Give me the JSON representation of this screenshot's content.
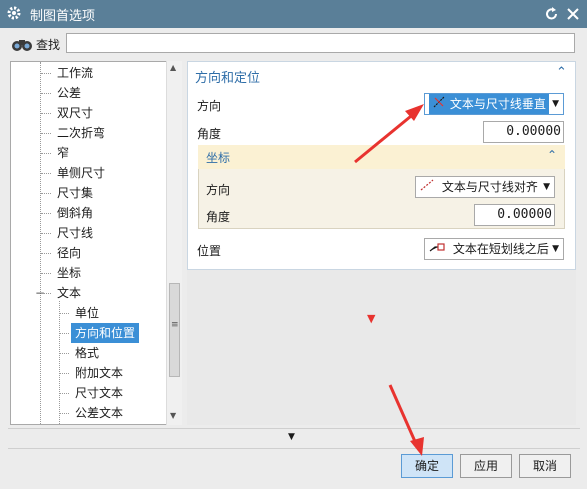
{
  "window": {
    "title": "制图首选项"
  },
  "search": {
    "label": "查找",
    "value": ""
  },
  "tree": {
    "items": [
      {
        "label": "工作流",
        "level": 1
      },
      {
        "label": "公差",
        "level": 1
      },
      {
        "label": "双尺寸",
        "level": 1
      },
      {
        "label": "二次折弯",
        "level": 1
      },
      {
        "label": "窄",
        "level": 1
      },
      {
        "label": "单侧尺寸",
        "level": 1
      },
      {
        "label": "尺寸集",
        "level": 1
      },
      {
        "label": "倒斜角",
        "level": 1
      },
      {
        "label": "尺寸线",
        "level": 1
      },
      {
        "label": "径向",
        "level": 1
      },
      {
        "label": "坐标",
        "level": 1
      },
      {
        "label": "文本",
        "level": 1,
        "expanded": true
      },
      {
        "label": "单位",
        "level": 2
      },
      {
        "label": "方向和位置",
        "level": 2,
        "selected": true
      },
      {
        "label": "格式",
        "level": 2
      },
      {
        "label": "附加文本",
        "level": 2
      },
      {
        "label": "尺寸文本",
        "level": 2
      },
      {
        "label": "公差文本",
        "level": 2
      }
    ],
    "collapse_glyph": "−"
  },
  "section": {
    "title": "方向和定位",
    "orientation_label": "方向",
    "orientation_value": "文本与尺寸线垂直",
    "angle_label": "角度",
    "angle_value": "0.00000",
    "coord": {
      "title": "坐标",
      "orientation_label": "方向",
      "orientation_value": "文本与尺寸线对齐",
      "angle_label": "角度",
      "angle_value": "0.00000"
    },
    "position_label": "位置",
    "position_value": "文本在短划线之后"
  },
  "footer": {
    "ok_label": "确定",
    "apply_label": "应用",
    "cancel_label": "取消"
  },
  "colors": {
    "titlebar": "#5a7f98",
    "accent": "#2f6ea8",
    "selection": "#3b8fd6",
    "annotation_arrow": "#e8332f"
  }
}
